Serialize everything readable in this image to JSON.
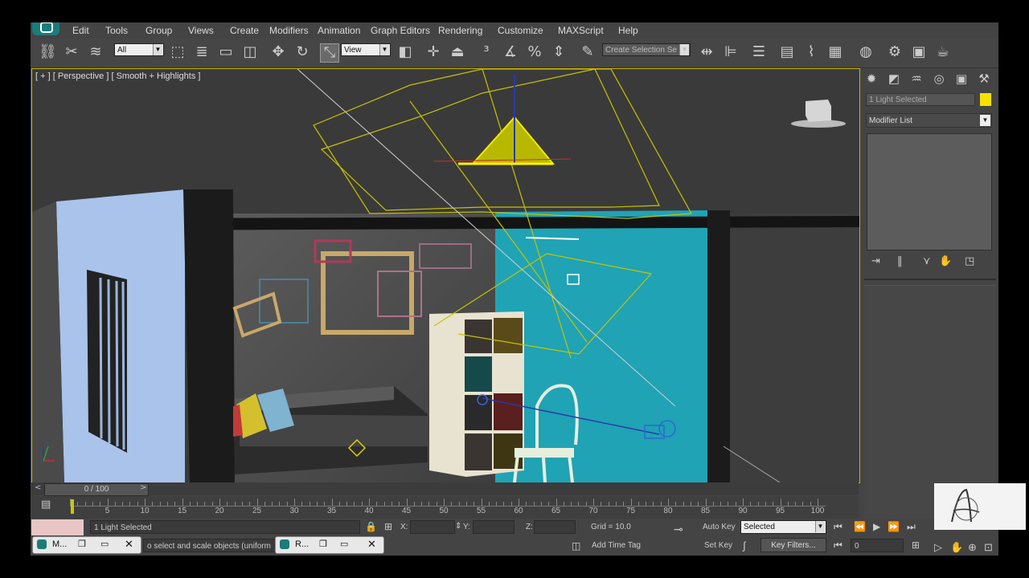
{
  "menu": {
    "items": [
      "Edit",
      "Tools",
      "Group",
      "Views",
      "Create",
      "Modifiers",
      "Animation",
      "Graph Editors",
      "Rendering",
      "Customize",
      "MAXScript",
      "Help"
    ]
  },
  "toolbar": {
    "selection_filter": "All",
    "reference_coord": "View",
    "named_selection_placeholder": "Create Selection Se"
  },
  "viewport": {
    "label": "[ + ] [ Perspective ] [ Smooth + Highlights ]"
  },
  "command_panel": {
    "object_name": "1 Light Selected",
    "object_color": "#f5e100",
    "modifier_list": "Modifier List"
  },
  "time": {
    "slider_text": "0 / 100",
    "ticks": [
      "5",
      "10",
      "15",
      "20",
      "25",
      "30",
      "35",
      "40",
      "45",
      "50",
      "55",
      "60",
      "65",
      "70",
      "75",
      "80",
      "85",
      "90",
      "95",
      "100"
    ]
  },
  "status": {
    "selection_count": "1 Light Selected",
    "prompt": "o select and scale objects (uniform",
    "x_label": "X:",
    "y_label": "Y:",
    "z_label": "Z:",
    "grid": "Grid = 10.0",
    "add_time_tag": "Add Time Tag",
    "auto_key": "Auto Key",
    "set_key": "Set Key",
    "key_mode": "Selected",
    "key_filters": "Key Filters...",
    "current_frame": "0"
  },
  "taskbar": {
    "app1_label": "M...",
    "app2_label": "R..."
  }
}
